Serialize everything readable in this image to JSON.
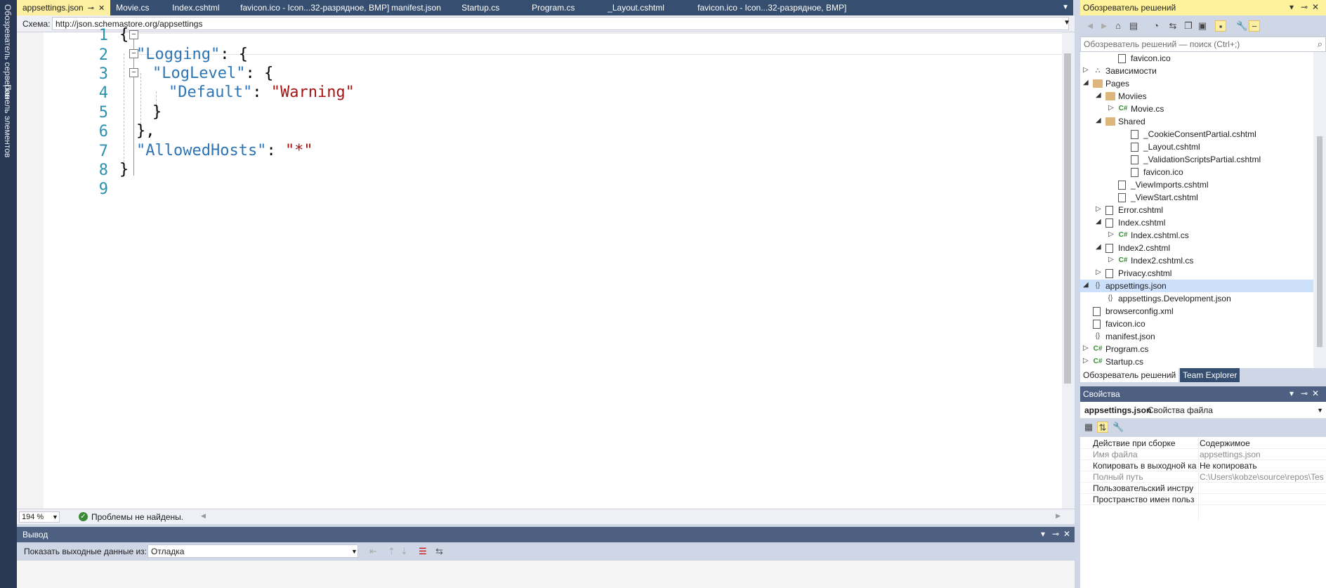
{
  "left_strip": {
    "item1": "Обозреватель серверов",
    "item2": "Панель элементов"
  },
  "tabs": [
    {
      "label": "appsettings.json",
      "active": true
    },
    {
      "label": "Movie.cs"
    },
    {
      "label": "Index.cshtml"
    },
    {
      "label": "favicon.ico - Icon...32-разрядное, BMP]"
    },
    {
      "label": "manifest.json"
    },
    {
      "label": "Startup.cs"
    },
    {
      "label": "Program.cs"
    },
    {
      "label": "_Layout.cshtml"
    },
    {
      "label": "favicon.ico - Icon...32-разрядное, BMP]"
    }
  ],
  "schema": {
    "label": "Схема:",
    "url": "http://json.schemastore.org/appsettings"
  },
  "editor": {
    "line_numbers": [
      "1",
      "2",
      "3",
      "4",
      "5",
      "6",
      "7",
      "8",
      "9"
    ],
    "lines": [
      {
        "p1": "{"
      },
      {
        "k": "\"Logging\"",
        "p1": ": {"
      },
      {
        "k": "\"LogLevel\"",
        "p1": ": {"
      },
      {
        "k": "\"Default\"",
        "p1": ": ",
        "s": "\"Warning\""
      },
      {
        "p1": "}"
      },
      {
        "p1": "},"
      },
      {
        "k": "\"AllowedHosts\"",
        "p1": ": ",
        "s": "\"*\""
      },
      {
        "p1": "}"
      }
    ]
  },
  "status": {
    "zoom": "194 %",
    "issues": "Проблемы не найдены."
  },
  "output": {
    "title": "Вывод",
    "show_label": "Показать выходные данные из:",
    "source": "Отладка"
  },
  "solution_explorer": {
    "title": "Обозреватель решений",
    "search_placeholder": "Обозреватель решений — поиск (Ctrl+;)",
    "nodes": [
      {
        "label": "favicon.ico",
        "indent": 3,
        "arrow": "",
        "icon": "file"
      },
      {
        "label": "Зависимости",
        "indent": 1,
        "arrow": "▷",
        "icon": "dep"
      },
      {
        "label": "Pages",
        "indent": 1,
        "arrow": "◢",
        "icon": "folder"
      },
      {
        "label": "Moviies",
        "indent": 2,
        "arrow": "◢",
        "icon": "folder"
      },
      {
        "label": "Movie.cs",
        "indent": 3,
        "arrow": "▷",
        "icon": "cs"
      },
      {
        "label": "Shared",
        "indent": 2,
        "arrow": "◢",
        "icon": "folder"
      },
      {
        "label": "_CookieConsentPartial.cshtml",
        "indent": 4,
        "arrow": "",
        "icon": "file"
      },
      {
        "label": "_Layout.cshtml",
        "indent": 4,
        "arrow": "",
        "icon": "file"
      },
      {
        "label": "_ValidationScriptsPartial.cshtml",
        "indent": 4,
        "arrow": "",
        "icon": "file"
      },
      {
        "label": "favicon.ico",
        "indent": 4,
        "arrow": "",
        "icon": "file"
      },
      {
        "label": "_ViewImports.cshtml",
        "indent": 3,
        "arrow": "",
        "icon": "file"
      },
      {
        "label": "_ViewStart.cshtml",
        "indent": 3,
        "arrow": "",
        "icon": "file"
      },
      {
        "label": "Error.cshtml",
        "indent": 2,
        "arrow": "▷",
        "icon": "file"
      },
      {
        "label": "Index.cshtml",
        "indent": 2,
        "arrow": "◢",
        "icon": "file"
      },
      {
        "label": "Index.cshtml.cs",
        "indent": 3,
        "arrow": "▷",
        "icon": "cs"
      },
      {
        "label": "Index2.cshtml",
        "indent": 2,
        "arrow": "◢",
        "icon": "file"
      },
      {
        "label": "Index2.cshtml.cs",
        "indent": 3,
        "arrow": "▷",
        "icon": "cs"
      },
      {
        "label": "Privacy.cshtml",
        "indent": 2,
        "arrow": "▷",
        "icon": "file"
      },
      {
        "label": "appsettings.json",
        "indent": 1,
        "arrow": "◢",
        "icon": "json",
        "selected": true
      },
      {
        "label": "appsettings.Development.json",
        "indent": 2,
        "arrow": "",
        "icon": "json"
      },
      {
        "label": "browserconfig.xml",
        "indent": 1,
        "arrow": "",
        "icon": "file"
      },
      {
        "label": "favicon.ico",
        "indent": 1,
        "arrow": "",
        "icon": "file"
      },
      {
        "label": "manifest.json",
        "indent": 1,
        "arrow": "",
        "icon": "json"
      },
      {
        "label": "Program.cs",
        "indent": 1,
        "arrow": "▷",
        "icon": "cs"
      },
      {
        "label": "Startup.cs",
        "indent": 1,
        "arrow": "▷",
        "icon": "cs"
      }
    ],
    "bottom_tabs": [
      "Обозреватель решений",
      "Team Explorer"
    ]
  },
  "properties": {
    "title": "Свойства",
    "object_name": "appsettings.json",
    "object_type": "Свойства файла",
    "rows": [
      {
        "name": "Действие при сборке",
        "value": "Содержимое",
        "ro": false
      },
      {
        "name": "Имя файла",
        "value": "appsettings.json",
        "ro": true
      },
      {
        "name": "Копировать в выходной ка",
        "value": "Не копировать",
        "ro": false
      },
      {
        "name": "Полный путь",
        "value": "C:\\Users\\kobze\\source\\repos\\Tes",
        "ro": true
      },
      {
        "name": "Пользовательский инстру",
        "value": "",
        "ro": false
      },
      {
        "name": "Пространство имен польз",
        "value": "",
        "ro": false
      }
    ]
  }
}
